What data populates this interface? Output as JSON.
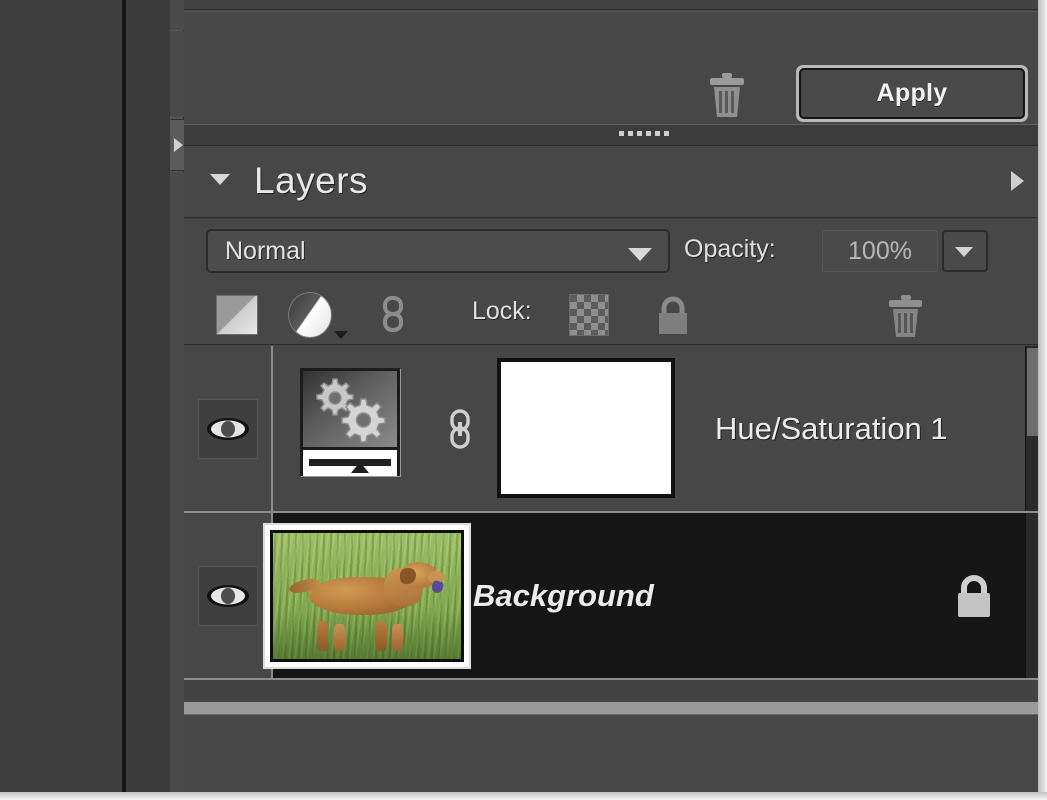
{
  "app": {
    "panel_bin_title": "Layers"
  },
  "adjustment_panel": {
    "delete_icon": "trash-icon",
    "apply_label": "Apply"
  },
  "layers_panel": {
    "title": "Layers",
    "collapse_icon": "triangle-down-icon",
    "menu_icon": "triangle-right-icon",
    "blend_mode": {
      "value": "Normal",
      "caret_icon": "chevron-down-icon"
    },
    "opacity": {
      "label": "Opacity:",
      "value": "100%",
      "stepper_icon": "chevron-down-icon"
    },
    "toolbar": {
      "new_layer_icon": "new-layer-icon",
      "adjustment_layer_icon": "adjustment-layer-icon",
      "link_layers_icon": "link-icon",
      "lock_label": "Lock:",
      "lock_transparency_icon": "checkerboard-icon",
      "lock_all_icon": "padlock-icon",
      "delete_layer_icon": "trash-icon"
    },
    "layers": [
      {
        "name": "Hue/Saturation 1",
        "visible": true,
        "selected": false,
        "thumbnail": "adjustment-gears-thumbnail",
        "has_mask": true,
        "mask_color": "#ffffff",
        "link_icon": "chain-link-icon",
        "locked": false
      },
      {
        "name": "Background",
        "visible": true,
        "selected": true,
        "thumbnail": "dog-photo-thumbnail",
        "has_mask": false,
        "link_icon": "",
        "locked": true,
        "lock_icon": "padlock-icon"
      }
    ],
    "visibility_icon": "eye-icon",
    "scrollbar": "vertical-scrollbar"
  },
  "workspace": {
    "expand_panel_icon": "triangle-right-icon"
  },
  "colors": {
    "panel_bg": "#474747",
    "panel_bg_alt": "#434343",
    "selected_row": "#161616",
    "text": "#ececec",
    "divider": "#8d8d8d"
  }
}
